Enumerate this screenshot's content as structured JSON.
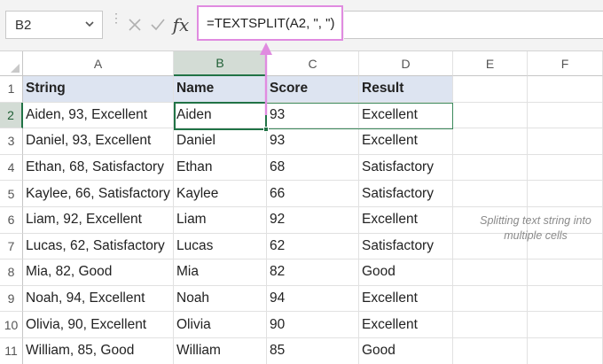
{
  "formula_bar": {
    "name_box": "B2",
    "fx_label": "fx",
    "formula": "=TEXTSPLIT(A2, \", \")"
  },
  "columns": [
    "A",
    "B",
    "C",
    "D",
    "E",
    "F"
  ],
  "selected_column": "B",
  "selected_row": "2",
  "rows": [
    {
      "num": "1",
      "cells": [
        "String",
        "Name",
        "Score",
        "Result",
        "",
        ""
      ]
    },
    {
      "num": "2",
      "cells": [
        "Aiden, 93, Excellent",
        "Aiden",
        "93",
        "Excellent",
        "",
        ""
      ]
    },
    {
      "num": "3",
      "cells": [
        "Daniel, 93, Excellent",
        "Daniel",
        "93",
        "Excellent",
        "",
        ""
      ]
    },
    {
      "num": "4",
      "cells": [
        "Ethan, 68, Satisfactory",
        "Ethan",
        "68",
        "Satisfactory",
        "",
        ""
      ]
    },
    {
      "num": "5",
      "cells": [
        "Kaylee, 66, Satisfactory",
        "Kaylee",
        "66",
        "Satisfactory",
        "",
        ""
      ]
    },
    {
      "num": "6",
      "cells": [
        "Liam, 92, Excellent",
        "Liam",
        "92",
        "Excellent",
        "",
        ""
      ]
    },
    {
      "num": "7",
      "cells": [
        "Lucas, 62, Satisfactory",
        "Lucas",
        "62",
        "Satisfactory",
        "",
        ""
      ]
    },
    {
      "num": "8",
      "cells": [
        "Mia, 82, Good",
        "Mia",
        "82",
        "Good",
        "",
        ""
      ]
    },
    {
      "num": "9",
      "cells": [
        "Noah, 94, Excellent",
        "Noah",
        "94",
        "Excellent",
        "",
        ""
      ]
    },
    {
      "num": "10",
      "cells": [
        "Olivia, 90, Excellent",
        "Olivia",
        "90",
        "Excellent",
        "",
        ""
      ]
    },
    {
      "num": "11",
      "cells": [
        "William, 85, Good",
        "William",
        "85",
        "Good",
        "",
        ""
      ]
    }
  ],
  "annotation": "Splitting text string into multiple cells",
  "colors": {
    "header_fill": "#dde4f1",
    "selection_green": "#217346",
    "formula_highlight": "#e08be0"
  }
}
